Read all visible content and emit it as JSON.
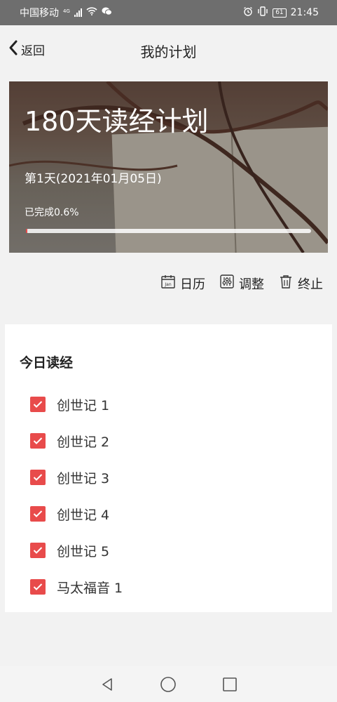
{
  "status_bar": {
    "carrier": "中国移动",
    "network": "4G",
    "time": "21:45",
    "battery": "61"
  },
  "nav": {
    "back_label": "返回",
    "title": "我的计划"
  },
  "plan": {
    "title": "180天读经计划",
    "day_text": "第1天(2021年01月05日)",
    "progress_text": "已完成0.6%",
    "progress_fraction": 0.006
  },
  "actions": {
    "calendar": "日历",
    "calendar_icon_text": "Jan",
    "adjust": "调整",
    "stop": "终止"
  },
  "today": {
    "title": "今日读经",
    "items": [
      {
        "label": "创世记 1",
        "checked": true
      },
      {
        "label": "创世记 2",
        "checked": true
      },
      {
        "label": "创世记 3",
        "checked": true
      },
      {
        "label": "创世记 4",
        "checked": true
      },
      {
        "label": "创世记 5",
        "checked": true
      },
      {
        "label": "马太福音 1",
        "checked": true
      }
    ]
  },
  "colors": {
    "accent": "#e84b4b",
    "status_bar": "#6e6e6e",
    "background": "#f2f2f2"
  }
}
